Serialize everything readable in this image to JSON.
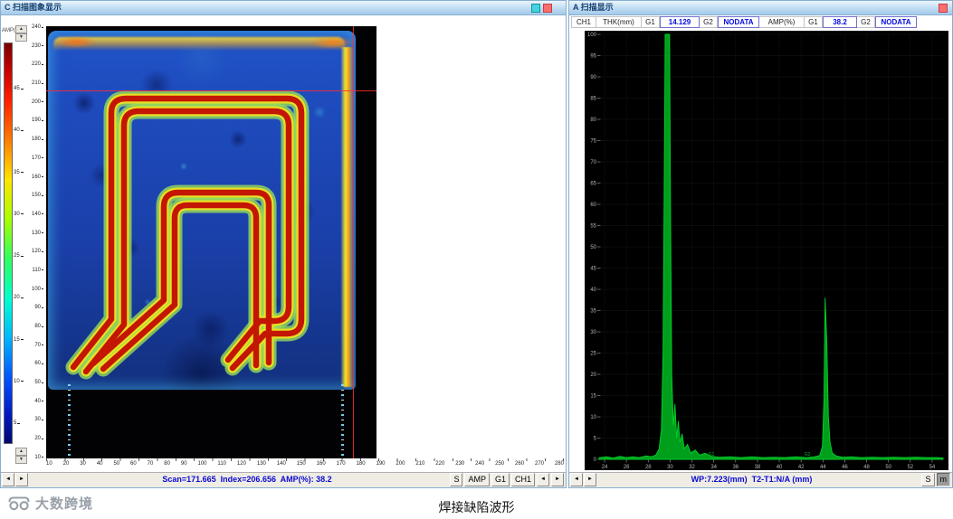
{
  "icons": {
    "arrow_left": "◄",
    "arrow_right": "►",
    "spin_up": "▲",
    "spin_down": "▼"
  },
  "left_panel": {
    "title": "C 扫描图象显示",
    "colorbar_label": "AMP(%)",
    "colorbar_ticks": [
      "45",
      "40",
      "35",
      "30",
      "25",
      "20",
      "15",
      "10",
      "5"
    ],
    "v_ruler": [
      "240",
      "230",
      "220",
      "210",
      "200",
      "190",
      "180",
      "170",
      "160",
      "150",
      "140",
      "130",
      "120",
      "110",
      "100",
      "90",
      "80",
      "70",
      "60",
      "50",
      "40",
      "30",
      "20",
      "10"
    ],
    "h_ruler": [
      "10",
      "20",
      "30",
      "40",
      "50",
      "60",
      "70",
      "80",
      "90",
      "100",
      "110",
      "120",
      "130",
      "140",
      "150",
      "160",
      "170",
      "180",
      "190",
      "200",
      "210",
      "220",
      "230",
      "240",
      "250",
      "260",
      "270",
      "280"
    ],
    "status_text": "Scan=171.665  Index=206.656  AMP(%): 38.2",
    "readout": {
      "scan": 171.665,
      "index": 206.656,
      "amp_pct": 38.2
    },
    "buttons": {
      "s": "S",
      "amp": "AMP",
      "g1": "G1",
      "ch1": "CH1"
    }
  },
  "right_panel": {
    "title": "A 扫描显示",
    "header_cells": [
      {
        "text": "CH1",
        "type": "label",
        "name": "ch1-label"
      },
      {
        "text": "THK(mm)",
        "type": "label",
        "name": "thk-label"
      },
      {
        "text": "G1",
        "type": "label",
        "name": "thk-g1-label"
      },
      {
        "text": "14.129",
        "type": "value",
        "name": "thk-g1-value"
      },
      {
        "text": "G2",
        "type": "label",
        "name": "thk-g2-label"
      },
      {
        "text": "NODATA",
        "type": "value",
        "name": "thk-g2-value"
      },
      {
        "text": "AMP(%)",
        "type": "label",
        "name": "amp-label"
      },
      {
        "text": "G1",
        "type": "label",
        "name": "amp-g1-label"
      },
      {
        "text": "38.2",
        "type": "value",
        "name": "amp-g1-value"
      },
      {
        "text": "G2",
        "type": "label",
        "name": "amp-g2-label"
      },
      {
        "text": "NODATA",
        "type": "value",
        "name": "amp-g2-value"
      }
    ],
    "status_text": "WP:7.223(mm)  T2-T1:N/A (mm)",
    "buttons": {
      "s": "S",
      "m": "m"
    }
  },
  "footer": {
    "logo_text": "大数跨境",
    "caption": "焊接缺陷波形"
  },
  "chart_data": {
    "type": "line",
    "title": "A-scan ultrasonic echo waveform",
    "xlabel": "",
    "ylabel": "",
    "xlim": [
      23.5,
      55
    ],
    "ylim": [
      0,
      100
    ],
    "xticks": [
      24,
      26,
      28,
      30,
      32,
      34,
      36,
      38,
      40,
      42,
      44,
      46,
      48,
      50,
      52,
      54
    ],
    "yticks": [
      0,
      5,
      10,
      15,
      20,
      25,
      30,
      35,
      40,
      45,
      50,
      55,
      60,
      65,
      70,
      75,
      80,
      85,
      90,
      95,
      100
    ],
    "line_color": "#00d22a",
    "background": "#000000",
    "grid": true,
    "legend": "none",
    "points": [
      [
        23.5,
        0.4
      ],
      [
        24.2,
        0.6
      ],
      [
        24.8,
        0.3
      ],
      [
        25.4,
        0.7
      ],
      [
        26.0,
        0.4
      ],
      [
        26.6,
        0.6
      ],
      [
        27.2,
        0.4
      ],
      [
        27.8,
        0.8
      ],
      [
        28.3,
        0.6
      ],
      [
        28.7,
        1.0
      ],
      [
        29.0,
        2.5
      ],
      [
        29.2,
        7
      ],
      [
        29.35,
        25
      ],
      [
        29.45,
        60
      ],
      [
        29.55,
        100
      ],
      [
        29.95,
        100
      ],
      [
        30.05,
        55
      ],
      [
        30.15,
        20
      ],
      [
        30.3,
        8
      ],
      [
        30.45,
        13
      ],
      [
        30.6,
        5
      ],
      [
        30.75,
        9
      ],
      [
        30.9,
        4
      ],
      [
        31.1,
        6
      ],
      [
        31.3,
        2.5
      ],
      [
        31.6,
        3.5
      ],
      [
        31.9,
        1.5
      ],
      [
        32.3,
        2.2
      ],
      [
        32.7,
        1.0
      ],
      [
        33.2,
        1.4
      ],
      [
        33.8,
        0.7
      ],
      [
        34.5,
        0.5
      ],
      [
        35.5,
        0.6
      ],
      [
        36.5,
        0.4
      ],
      [
        37.5,
        0.6
      ],
      [
        38.5,
        0.4
      ],
      [
        39.5,
        0.5
      ],
      [
        40.5,
        0.4
      ],
      [
        41.5,
        0.6
      ],
      [
        42.5,
        0.4
      ],
      [
        43.2,
        0.6
      ],
      [
        43.7,
        0.9
      ],
      [
        43.95,
        3
      ],
      [
        44.1,
        14
      ],
      [
        44.2,
        38
      ],
      [
        44.35,
        28
      ],
      [
        44.5,
        10
      ],
      [
        44.65,
        4
      ],
      [
        44.85,
        1.5
      ],
      [
        45.2,
        0.8
      ],
      [
        45.8,
        0.5
      ],
      [
        46.6,
        0.6
      ],
      [
        47.5,
        0.4
      ],
      [
        48.5,
        0.5
      ],
      [
        49.5,
        0.4
      ],
      [
        50.5,
        0.5
      ],
      [
        51.5,
        0.4
      ],
      [
        52.5,
        0.5
      ],
      [
        53.5,
        0.4
      ],
      [
        54.5,
        0.4
      ],
      [
        55,
        0.3
      ]
    ],
    "peaks": [
      {
        "x": 29.8,
        "amplitude": 100
      },
      {
        "x": 44.2,
        "amplitude": 38.2
      }
    ],
    "gates": [
      {
        "label": "G1",
        "x": 33.5
      },
      {
        "label": "G2",
        "x": 42.3
      }
    ],
    "readouts": {
      "thk_mm_g1": "14.129",
      "thk_mm_g2": "NODATA",
      "amp_pct_g1": "38.2",
      "amp_pct_g2": "NODATA",
      "wp_mm": "7.223",
      "t2_t1": "N/A"
    }
  }
}
